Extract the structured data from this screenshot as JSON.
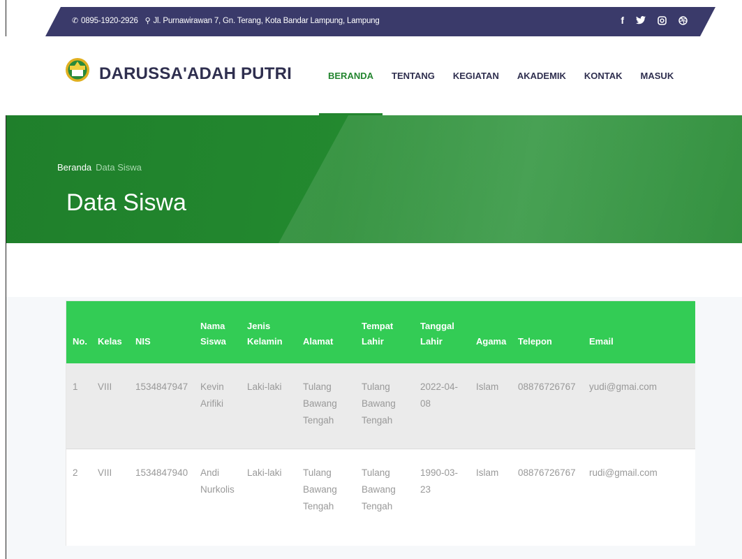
{
  "topbar": {
    "phone": "0895-1920-2926",
    "address": "Jl. Purnawirawan 7, Gn. Terang, Kota Bandar Lampung, Lampung",
    "phone_icon": "phone-icon",
    "location_icon": "map-marker-icon",
    "social": [
      "facebook-icon",
      "twitter-icon",
      "instagram-icon",
      "dribbble-icon"
    ]
  },
  "header": {
    "brand": "DARUSSA'ADAH PUTRI",
    "nav": [
      "BERANDA",
      "TENTANG",
      "KEGIATAN",
      "AKADEMIK",
      "KONTAK",
      "MASUK"
    ],
    "active_nav": "BERANDA"
  },
  "hero": {
    "breadcrumb_home": "Beranda",
    "breadcrumb_current": "Data Siswa",
    "title": "Data Siswa"
  },
  "table": {
    "headers": [
      "No.",
      "Kelas",
      "NIS",
      "Nama Siswa",
      "Jenis Kelamin",
      "Alamat",
      "Tempat Lahir",
      "Tanggal Lahir",
      "Agama",
      "Telepon",
      "Email"
    ],
    "rows": [
      [
        "1",
        "VIII",
        "1534847947",
        "Kevin Arifiki",
        "Laki-laki",
        "Tulang Bawang Tengah",
        "Tulang Bawang Tengah",
        "2022-04-08",
        "Islam",
        "08876726767",
        "yudi@gmai.com"
      ],
      [
        "2",
        "VIII",
        "1534847940",
        "Andi Nurkolis",
        "Laki-laki",
        "Tulang Bawang Tengah",
        "Tulang Bawang Tengah",
        "1990-03-23",
        "Islam",
        "08876726767",
        "rudi@gmail.com"
      ]
    ]
  },
  "colors": {
    "topbar": "#3a3a6a",
    "brand_text": "#2f2f4f",
    "accent_green": "#23852f",
    "table_header": "#33cc55"
  }
}
